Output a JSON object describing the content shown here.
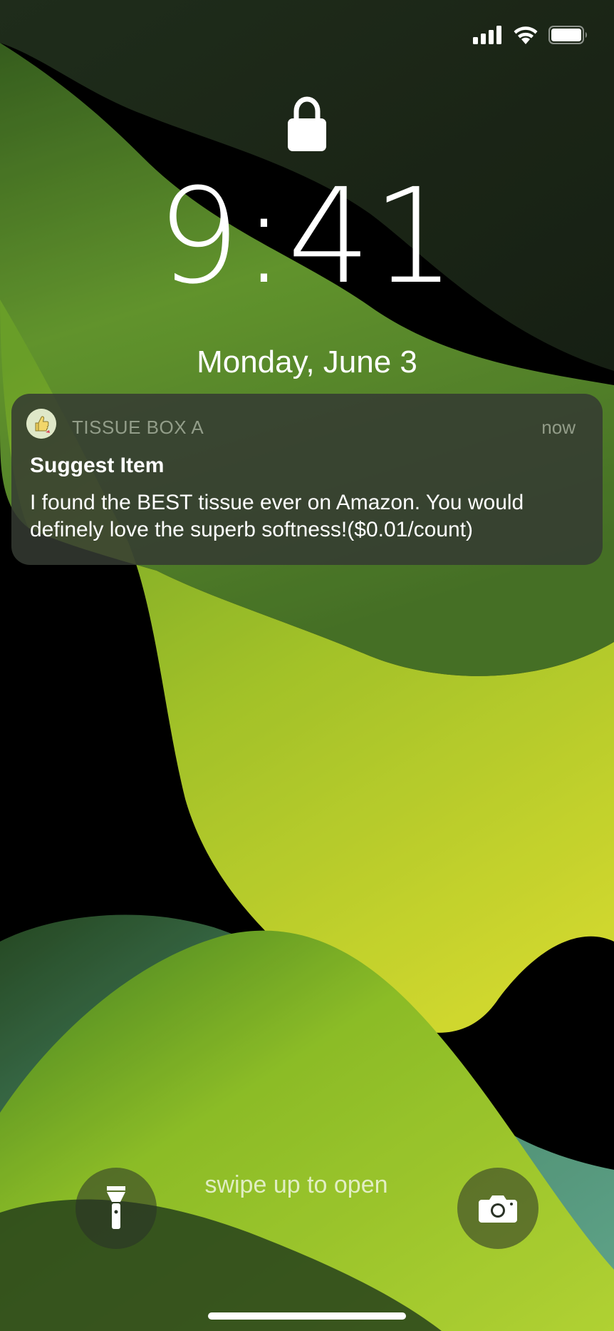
{
  "status_bar": {
    "signal_icon": "cellular-signal-icon",
    "wifi_icon": "wifi-icon",
    "battery_icon": "battery-icon",
    "battery_level": 1.0
  },
  "lock_screen": {
    "lock_icon": "padlock-icon",
    "time": "9:41",
    "date": "Monday, June 3"
  },
  "notification": {
    "app_icon": "thumbs-up-icon",
    "app_name": "TISSUE BOX A",
    "timestamp": "now",
    "title": "Suggest Item",
    "body": "I found the BEST tissue ever on Amazon. You would definely love the superb softness!($0.01/count)"
  },
  "bottom": {
    "swipe_hint": "swipe up to open",
    "left_button_icon": "flashlight-icon",
    "right_button_icon": "camera-icon"
  },
  "colors": {
    "notification_bg": "#343a32",
    "wallpaper_lime": "#d8ec2c",
    "wallpaper_green": "#7fb83a",
    "wallpaper_teal": "#6cc7a0"
  }
}
